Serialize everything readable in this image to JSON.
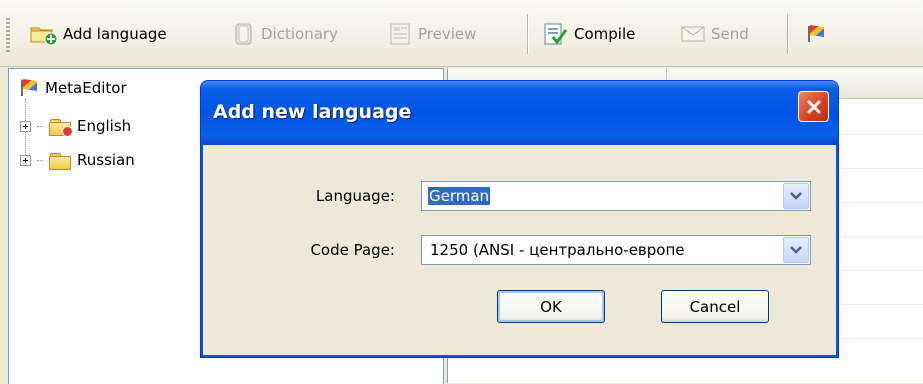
{
  "toolbar": {
    "add_language": "Add language",
    "dictionary": "Dictionary",
    "preview": "Preview",
    "compile": "Compile",
    "send": "Send"
  },
  "tree": {
    "root": "MetaEditor",
    "items": [
      {
        "label": "English"
      },
      {
        "label": "Russian"
      }
    ]
  },
  "dialog": {
    "title": "Add new language",
    "language_label": "Language:",
    "language_value": "German",
    "codepage_label": "Code Page:",
    "codepage_value": "1250  (ANSI - центрально-европе",
    "ok_label": "OK",
    "cancel_label": "Cancel"
  },
  "colors": {
    "titlebar": "#0054e3",
    "selection": "#316ac5",
    "close": "#d5401f"
  }
}
